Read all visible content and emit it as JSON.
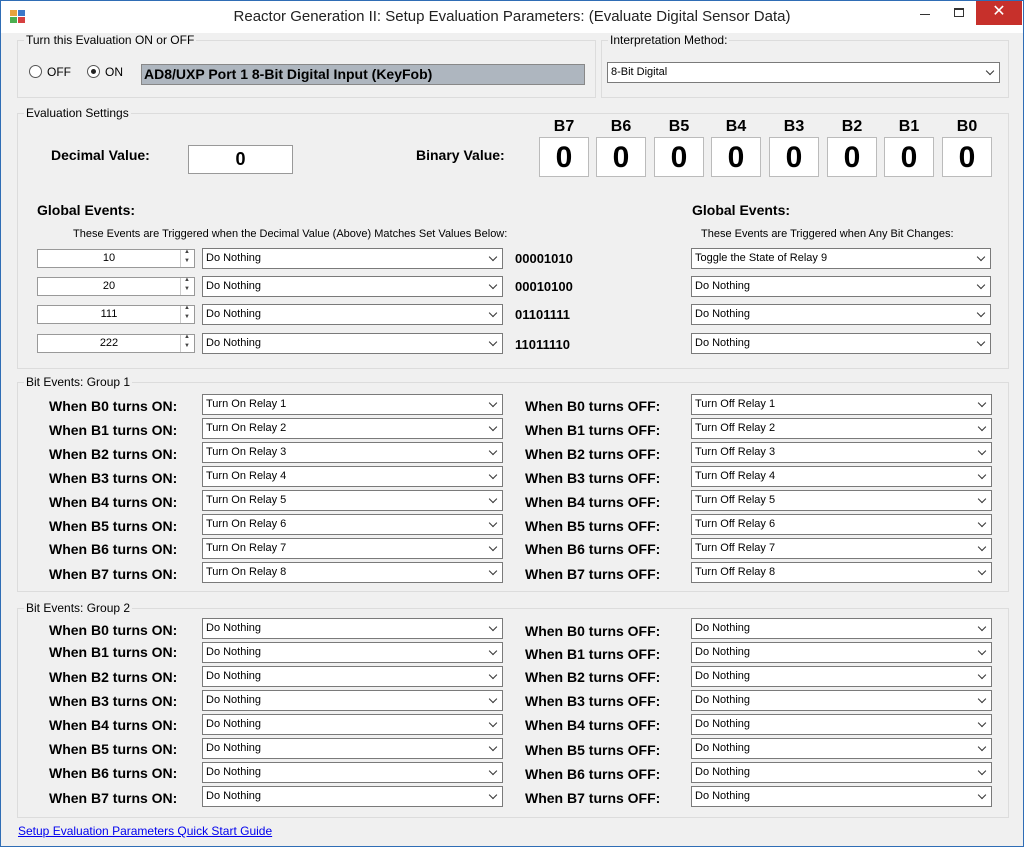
{
  "window": {
    "title": "Reactor Generation II: Setup Evaluation Parameters: (Evaluate Digital Sensor Data)",
    "close_glyph": "✕"
  },
  "onoff": {
    "legend": "Turn this Evaluation ON or OFF",
    "off_label": "OFF",
    "on_label": "ON",
    "selected": "ON",
    "name": "AD8/UXP Port 1 8-Bit Digital Input (KeyFob)"
  },
  "interp": {
    "legend": "Interpretation Method:",
    "value": "8-Bit Digital"
  },
  "settings": {
    "legend": "Evaluation Settings",
    "decimal_label": "Decimal Value:",
    "decimal_value": "0",
    "binary_label": "Binary Value:",
    "bits": [
      {
        "name": "B7",
        "value": "0"
      },
      {
        "name": "B6",
        "value": "0"
      },
      {
        "name": "B5",
        "value": "0"
      },
      {
        "name": "B4",
        "value": "0"
      },
      {
        "name": "B3",
        "value": "0"
      },
      {
        "name": "B2",
        "value": "0"
      },
      {
        "name": "B1",
        "value": "0"
      },
      {
        "name": "B0",
        "value": "0"
      }
    ],
    "global_left_title": "Global Events:",
    "global_left_sub": "These Events are Triggered when the Decimal Value (Above) Matches Set Values Below:",
    "global_right_title": "Global Events:",
    "global_right_sub": "These Events are Triggered when Any Bit Changes:",
    "value_rows": [
      {
        "value": "10",
        "action": "Do Nothing",
        "binary": "00001010",
        "bit_action": "Toggle the State of Relay 9"
      },
      {
        "value": "20",
        "action": "Do Nothing",
        "binary": "00010100",
        "bit_action": "Do Nothing"
      },
      {
        "value": "111",
        "action": "Do Nothing",
        "binary": "01101111",
        "bit_action": "Do Nothing"
      },
      {
        "value": "222",
        "action": "Do Nothing",
        "binary": "11011110",
        "bit_action": "Do Nothing"
      }
    ]
  },
  "group1": {
    "legend": "Bit Events: Group 1",
    "rows": [
      {
        "on_label": "When B0 turns ON:",
        "on_action": "Turn On Relay 1",
        "off_label": "When B0 turns OFF:",
        "off_action": "Turn Off Relay 1"
      },
      {
        "on_label": "When B1 turns ON:",
        "on_action": "Turn On Relay 2",
        "off_label": "When B1 turns OFF:",
        "off_action": "Turn Off Relay 2"
      },
      {
        "on_label": "When B2 turns ON:",
        "on_action": "Turn On Relay 3",
        "off_label": "When B2 turns OFF:",
        "off_action": "Turn Off Relay 3"
      },
      {
        "on_label": "When B3 turns ON:",
        "on_action": "Turn On Relay 4",
        "off_label": "When B3 turns OFF:",
        "off_action": "Turn Off Relay 4"
      },
      {
        "on_label": "When B4 turns ON:",
        "on_action": "Turn On Relay 5",
        "off_label": "When B4 turns OFF:",
        "off_action": "Turn Off Relay 5"
      },
      {
        "on_label": "When B5 turns ON:",
        "on_action": "Turn On Relay 6",
        "off_label": "When B5 turns OFF:",
        "off_action": "Turn Off Relay 6"
      },
      {
        "on_label": "When B6 turns ON:",
        "on_action": "Turn On Relay 7",
        "off_label": "When B6 turns OFF:",
        "off_action": "Turn Off Relay 7"
      },
      {
        "on_label": "When B7 turns ON:",
        "on_action": "Turn On Relay 8",
        "off_label": "When B7 turns OFF:",
        "off_action": "Turn Off Relay 8"
      }
    ]
  },
  "group2": {
    "legend": "Bit Events: Group 2",
    "rows": [
      {
        "on_label": "When B0 turns ON:",
        "on_action": "Do Nothing",
        "off_label": "When B0 turns OFF:",
        "off_action": "Do Nothing"
      },
      {
        "on_label": "When B1 turns ON:",
        "on_action": "Do Nothing",
        "off_label": "When B1 turns OFF:",
        "off_action": "Do Nothing"
      },
      {
        "on_label": "When B2 turns ON:",
        "on_action": "Do Nothing",
        "off_label": "When B2 turns OFF:",
        "off_action": "Do Nothing"
      },
      {
        "on_label": "When B3 turns ON:",
        "on_action": "Do Nothing",
        "off_label": "When B3 turns OFF:",
        "off_action": "Do Nothing"
      },
      {
        "on_label": "When B4 turns ON:",
        "on_action": "Do Nothing",
        "off_label": "When B4 turns OFF:",
        "off_action": "Do Nothing"
      },
      {
        "on_label": "When B5 turns ON:",
        "on_action": "Do Nothing",
        "off_label": "When B5 turns OFF:",
        "off_action": "Do Nothing"
      },
      {
        "on_label": "When B6 turns ON:",
        "on_action": "Do Nothing",
        "off_label": "When B6 turns OFF:",
        "off_action": "Do Nothing"
      },
      {
        "on_label": "When B7 turns ON:",
        "on_action": "Do Nothing",
        "off_label": "When B7 turns OFF:",
        "off_action": "Do Nothing"
      }
    ]
  },
  "footer": {
    "link": "Setup Evaluation Parameters Quick Start Guide"
  }
}
